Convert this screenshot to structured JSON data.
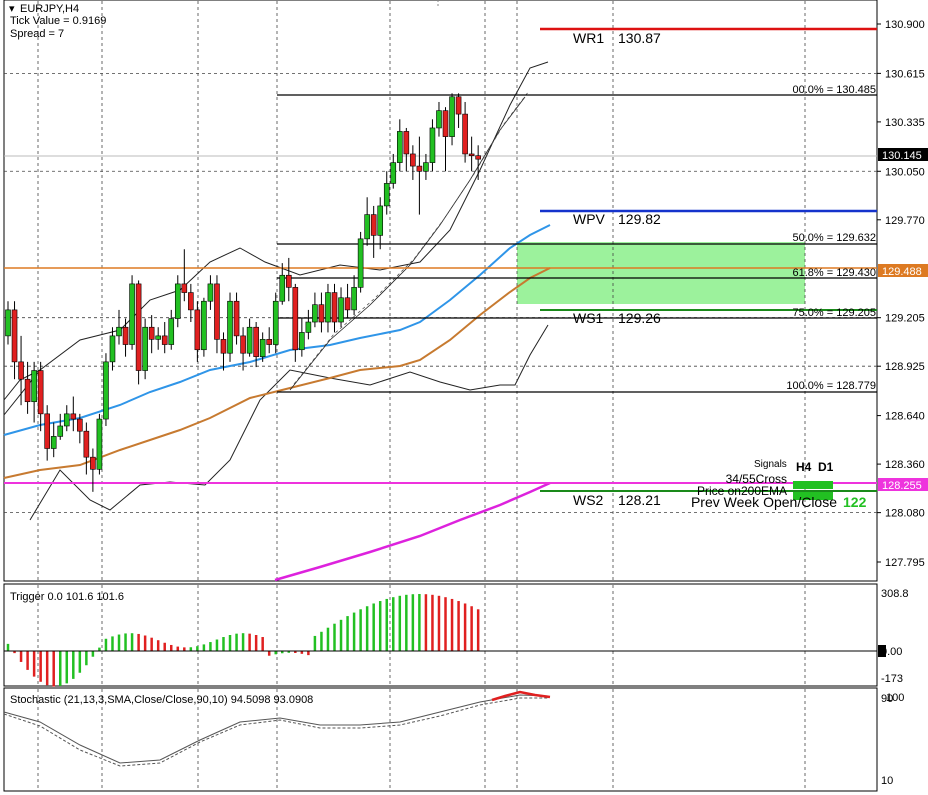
{
  "header": {
    "symbol": "EURJPY,H4",
    "tick_value": "Tick Value = 0.9169",
    "spread": "Spread = 7"
  },
  "price_axis": {
    "ticks": [
      "130.900",
      "130.615",
      "130.335",
      "130.050",
      "129.770",
      "129.205",
      "128.925",
      "128.640",
      "128.360",
      "128.080",
      "127.795"
    ],
    "current_price": "130.145",
    "orange_price": "129.488",
    "magenta_price": "128.255"
  },
  "pivots": {
    "wr1": {
      "label": "WR1",
      "value": "130.87"
    },
    "wpv": {
      "label": "WPV",
      "value": "129.82"
    },
    "ws1": {
      "label": "WS1",
      "value": "129.26"
    },
    "ws2": {
      "label": "WS2",
      "value": "128.21"
    }
  },
  "fib": {
    "f0": "00.0% = 130.485",
    "f50": "50.0% = 129.632",
    "f618": "61.8% = 129.430",
    "f75": "75.0% = 129.205",
    "f100": "100.0% = 128.779"
  },
  "signals": {
    "title": "Signals",
    "h4": "H4",
    "d1": "D1",
    "cross": "34/55Cross",
    "ema": "Price on200EMA",
    "prev_week": "Prev Week Open/Close",
    "prev_week_value": "122"
  },
  "trigger": {
    "label": "Trigger 0.0 101.6 101.6",
    "max": "308.8",
    "zero": "0.00",
    "min": "-173"
  },
  "stochastic": {
    "label": "Stochastic (21,13,3,SMA,Close/Close,90,10) 94.5098 93.0908",
    "top_a": "100",
    "top_b": "90",
    "bottom": "10"
  },
  "colors": {
    "bull": "#22c022",
    "bear": "#e02020",
    "wr1": "#dd1111",
    "wpv": "#1533cc",
    "orange": "#dd7a22",
    "magenta": "#ee33dd",
    "zone": "#9cf29c",
    "ema_blue": "#2f95e8",
    "ema_brown": "#c77a30",
    "ema_magenta": "#dd22dd"
  },
  "candles": [
    {
      "o": 129.1,
      "c": 129.25,
      "h": 129.3,
      "l": 129.05
    },
    {
      "o": 129.25,
      "c": 128.95,
      "h": 129.3,
      "l": 128.85
    },
    {
      "o": 128.95,
      "c": 128.85,
      "h": 129.1,
      "l": 128.7
    },
    {
      "o": 128.85,
      "c": 128.72,
      "h": 128.95,
      "l": 128.65
    },
    {
      "o": 128.72,
      "c": 128.9,
      "h": 128.95,
      "l": 128.6
    },
    {
      "o": 128.9,
      "c": 128.65,
      "h": 128.95,
      "l": 128.55
    },
    {
      "o": 128.65,
      "c": 128.45,
      "h": 128.7,
      "l": 128.38
    },
    {
      "o": 128.45,
      "c": 128.52,
      "h": 128.6,
      "l": 128.4
    },
    {
      "o": 128.52,
      "c": 128.58,
      "h": 128.65,
      "l": 128.5
    },
    {
      "o": 128.58,
      "c": 128.65,
      "h": 128.7,
      "l": 128.55
    },
    {
      "o": 128.65,
      "c": 128.62,
      "h": 128.75,
      "l": 128.55
    },
    {
      "o": 128.62,
      "c": 128.55,
      "h": 128.65,
      "l": 128.48
    },
    {
      "o": 128.55,
      "c": 128.4,
      "h": 128.6,
      "l": 128.3
    },
    {
      "o": 128.4,
      "c": 128.33,
      "h": 128.45,
      "l": 128.2
    },
    {
      "o": 128.33,
      "c": 128.62,
      "h": 128.65,
      "l": 128.3
    },
    {
      "o": 128.62,
      "c": 128.95,
      "h": 129.0,
      "l": 128.58
    },
    {
      "o": 128.95,
      "c": 129.1,
      "h": 129.15,
      "l": 128.9
    },
    {
      "o": 129.1,
      "c": 129.15,
      "h": 129.25,
      "l": 129.05
    },
    {
      "o": 129.15,
      "c": 129.05,
      "h": 129.2,
      "l": 128.98
    },
    {
      "o": 129.05,
      "c": 129.4,
      "h": 129.45,
      "l": 129.02
    },
    {
      "o": 129.4,
      "c": 128.9,
      "h": 129.42,
      "l": 128.82
    },
    {
      "o": 128.9,
      "c": 129.15,
      "h": 129.2,
      "l": 128.85
    },
    {
      "o": 129.15,
      "c": 129.08,
      "h": 129.22,
      "l": 129.0
    },
    {
      "o": 129.08,
      "c": 129.1,
      "h": 129.15,
      "l": 129.02
    },
    {
      "o": 129.1,
      "c": 129.05,
      "h": 129.18,
      "l": 129.0
    },
    {
      "o": 129.05,
      "c": 129.2,
      "h": 129.25,
      "l": 129.02
    },
    {
      "o": 129.2,
      "c": 129.4,
      "h": 129.45,
      "l": 129.15
    },
    {
      "o": 129.4,
      "c": 129.35,
      "h": 129.6,
      "l": 129.3
    },
    {
      "o": 129.35,
      "c": 129.25,
      "h": 129.4,
      "l": 129.18
    },
    {
      "o": 129.25,
      "c": 129.02,
      "h": 129.3,
      "l": 128.95
    },
    {
      "o": 129.02,
      "c": 129.3,
      "h": 129.32,
      "l": 128.98
    },
    {
      "o": 129.3,
      "c": 129.4,
      "h": 129.45,
      "l": 129.25
    },
    {
      "o": 129.4,
      "c": 129.08,
      "h": 129.45,
      "l": 129.0
    },
    {
      "o": 129.08,
      "c": 129.0,
      "h": 129.12,
      "l": 128.9
    },
    {
      "o": 129.0,
      "c": 129.3,
      "h": 129.35,
      "l": 128.95
    },
    {
      "o": 129.3,
      "c": 129.1,
      "h": 129.35,
      "l": 129.05
    },
    {
      "o": 129.1,
      "c": 129.0,
      "h": 129.15,
      "l": 128.9
    },
    {
      "o": 129.0,
      "c": 129.15,
      "h": 129.2,
      "l": 128.98
    },
    {
      "o": 129.15,
      "c": 128.98,
      "h": 129.18,
      "l": 128.92
    },
    {
      "o": 128.98,
      "c": 129.08,
      "h": 129.12,
      "l": 128.95
    },
    {
      "o": 129.08,
      "c": 129.05,
      "h": 129.15,
      "l": 129.0
    },
    {
      "o": 129.05,
      "c": 129.3,
      "h": 129.35,
      "l": 129.0
    },
    {
      "o": 129.3,
      "c": 129.45,
      "h": 129.52,
      "l": 129.28
    },
    {
      "o": 129.45,
      "c": 129.38,
      "h": 129.55,
      "l": 129.3
    },
    {
      "o": 129.38,
      "c": 129.02,
      "h": 129.4,
      "l": 128.95
    },
    {
      "o": 129.02,
      "c": 129.12,
      "h": 129.2,
      "l": 128.98
    },
    {
      "o": 129.12,
      "c": 129.18,
      "h": 129.25,
      "l": 129.08
    },
    {
      "o": 129.18,
      "c": 129.28,
      "h": 129.35,
      "l": 129.15
    },
    {
      "o": 129.28,
      "c": 129.18,
      "h": 129.35,
      "l": 129.12
    },
    {
      "o": 129.18,
      "c": 129.35,
      "h": 129.4,
      "l": 129.12
    },
    {
      "o": 129.35,
      "c": 129.18,
      "h": 129.4,
      "l": 129.12
    },
    {
      "o": 129.18,
      "c": 129.32,
      "h": 129.38,
      "l": 129.15
    },
    {
      "o": 129.32,
      "c": 129.25,
      "h": 129.4,
      "l": 129.2
    },
    {
      "o": 129.25,
      "c": 129.38,
      "h": 129.45,
      "l": 129.22
    },
    {
      "o": 129.38,
      "c": 129.66,
      "h": 129.7,
      "l": 129.35
    },
    {
      "o": 129.66,
      "c": 129.8,
      "h": 129.9,
      "l": 129.62
    },
    {
      "o": 129.8,
      "c": 129.68,
      "h": 129.85,
      "l": 129.55
    },
    {
      "o": 129.68,
      "c": 129.85,
      "h": 129.9,
      "l": 129.6
    },
    {
      "o": 129.85,
      "c": 129.98,
      "h": 130.05,
      "l": 129.8
    },
    {
      "o": 129.98,
      "c": 130.1,
      "h": 130.15,
      "l": 129.95
    },
    {
      "o": 130.1,
      "c": 130.28,
      "h": 130.35,
      "l": 130.05
    },
    {
      "o": 130.28,
      "c": 130.15,
      "h": 130.3,
      "l": 130.05
    },
    {
      "o": 130.15,
      "c": 130.08,
      "h": 130.2,
      "l": 130.0
    },
    {
      "o": 130.08,
      "c": 130.05,
      "h": 130.25,
      "l": 129.8
    },
    {
      "o": 130.05,
      "c": 130.1,
      "h": 130.15,
      "l": 130.0
    },
    {
      "o": 130.1,
      "c": 130.3,
      "h": 130.35,
      "l": 130.05
    },
    {
      "o": 130.3,
      "c": 130.4,
      "h": 130.45,
      "l": 130.25
    },
    {
      "o": 130.4,
      "c": 130.25,
      "h": 130.42,
      "l": 130.05
    },
    {
      "o": 130.25,
      "c": 130.48,
      "h": 130.5,
      "l": 130.2
    },
    {
      "o": 130.48,
      "c": 130.38,
      "h": 130.5,
      "l": 130.3
    },
    {
      "o": 130.38,
      "c": 130.15,
      "h": 130.45,
      "l": 130.1
    },
    {
      "o": 130.15,
      "c": 130.14,
      "h": 130.25,
      "l": 130.05
    },
    {
      "o": 130.14,
      "c": 130.12,
      "h": 130.2,
      "l": 130.0
    }
  ]
}
